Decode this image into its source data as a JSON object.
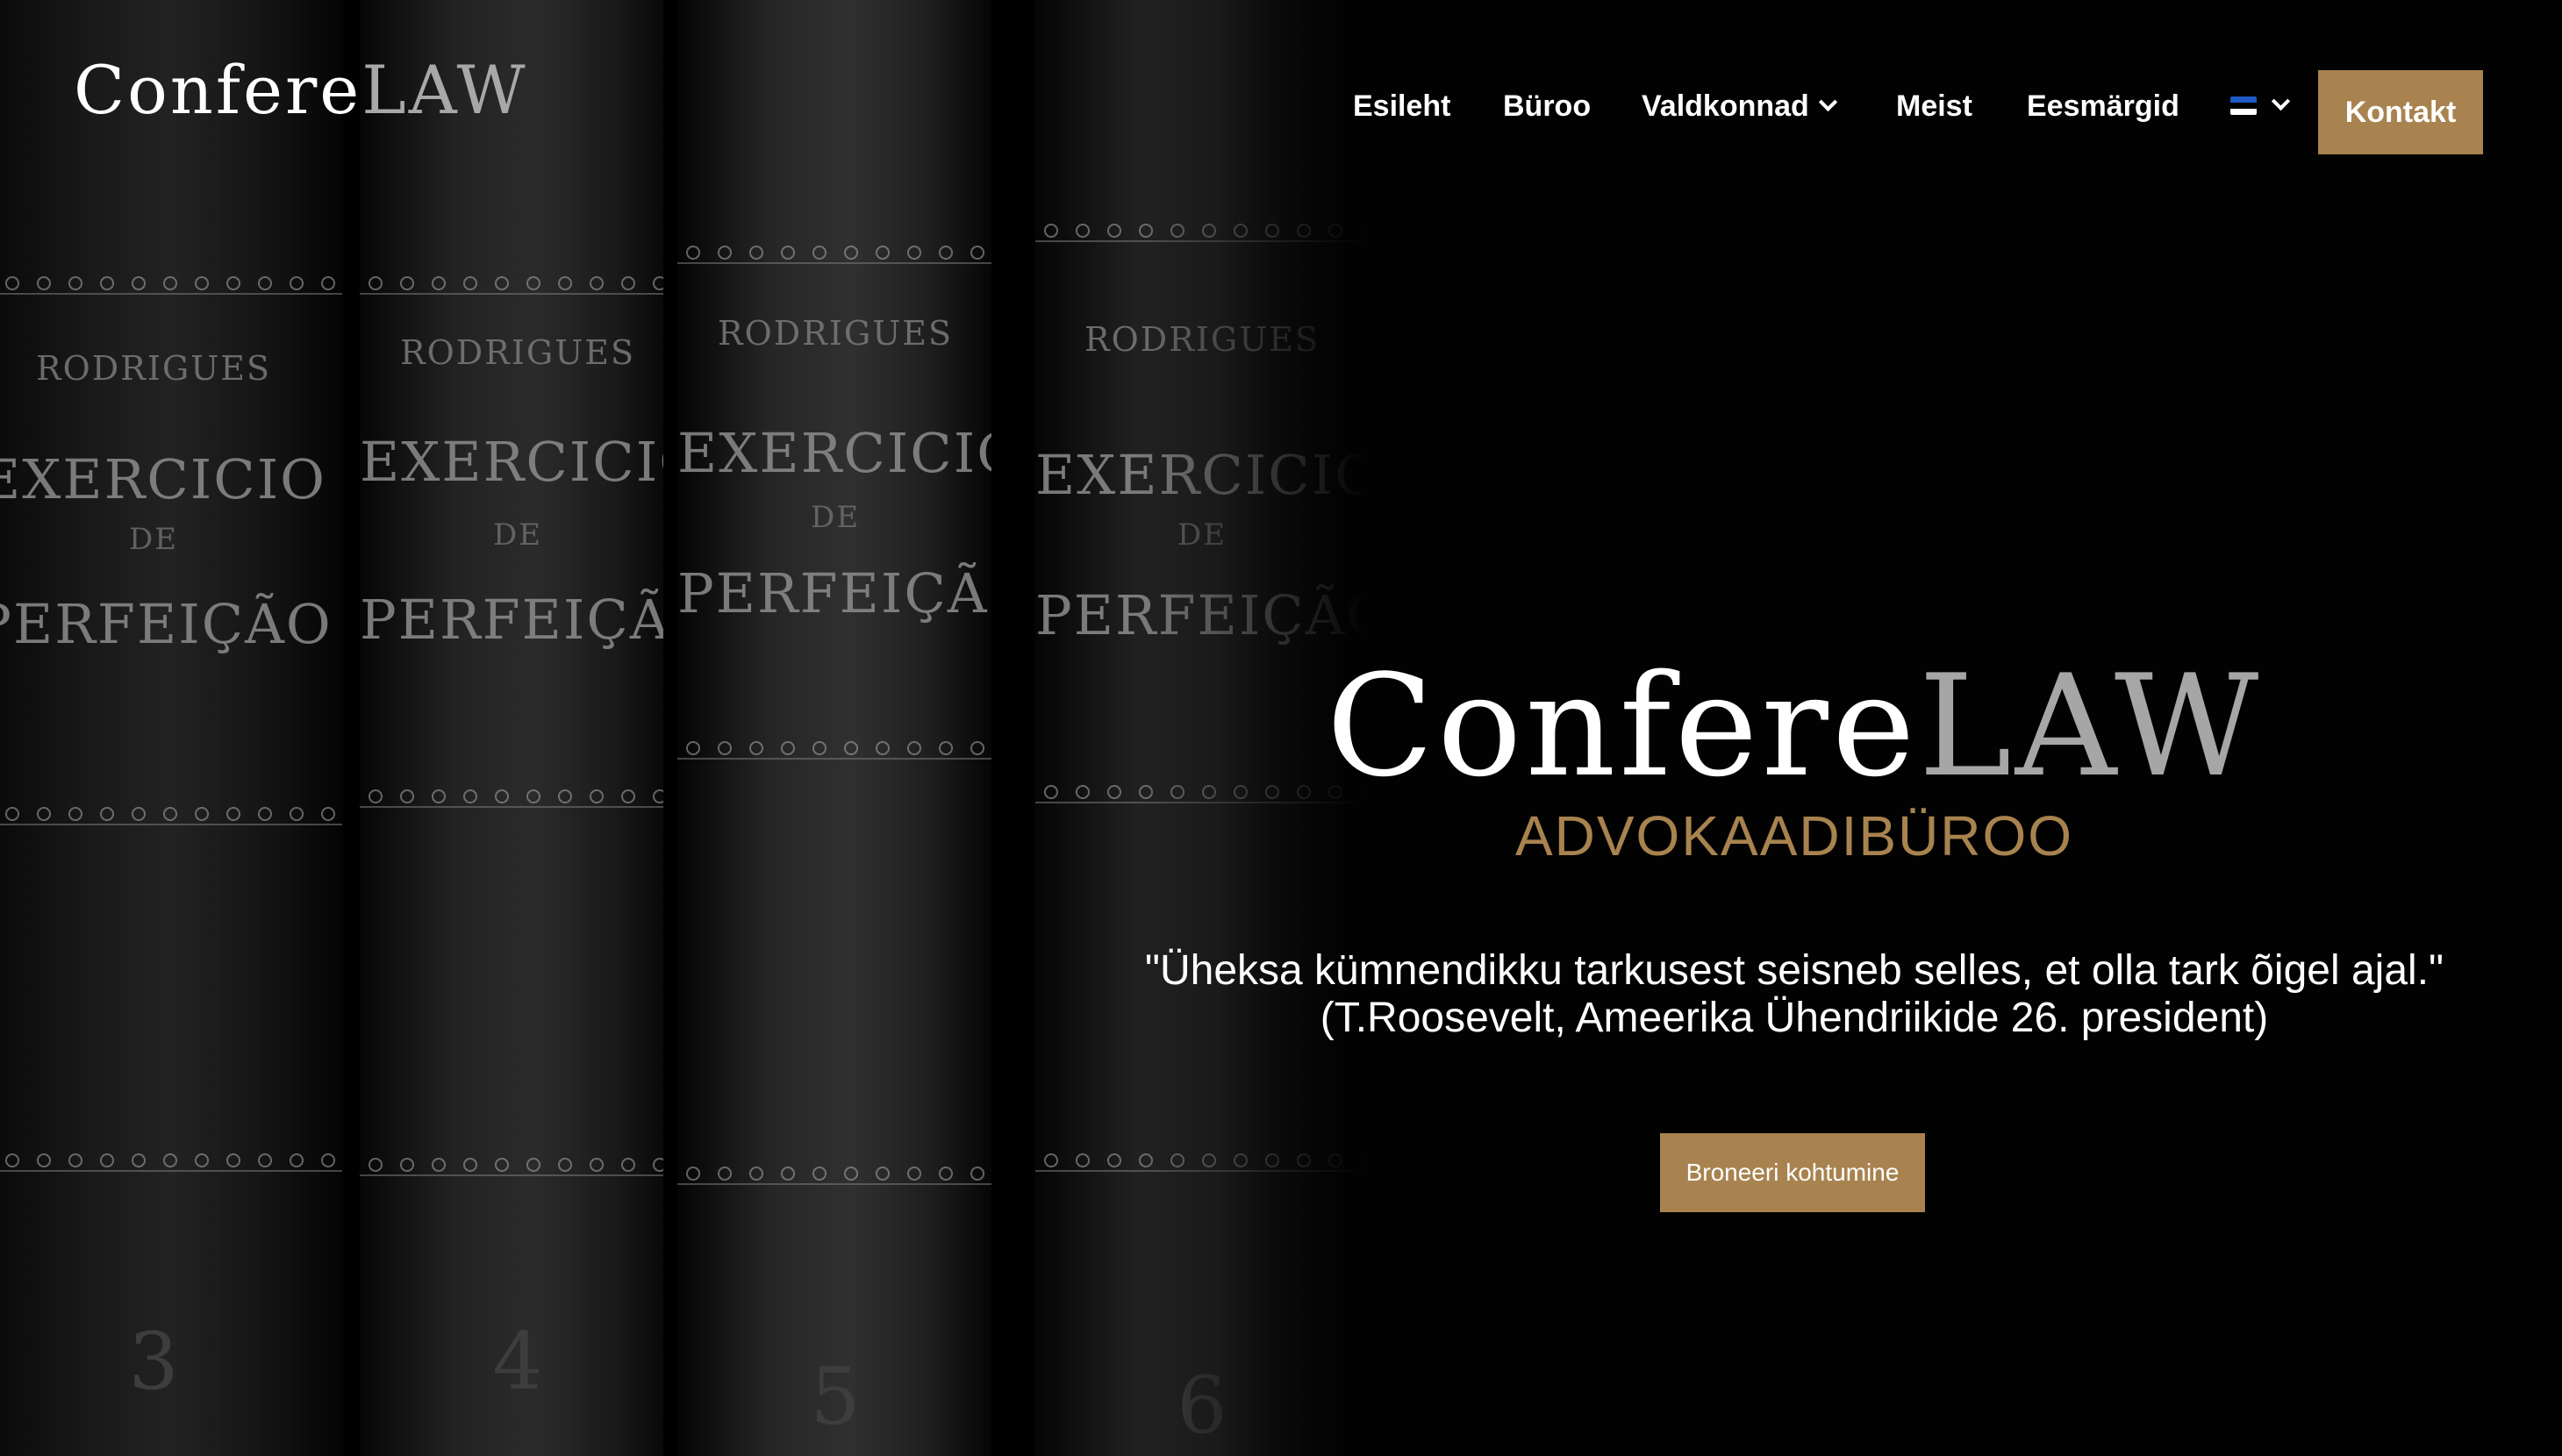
{
  "header": {
    "logo_part1": "Confere",
    "logo_part2": "LAW",
    "nav": [
      {
        "label": "Esileht"
      },
      {
        "label": "Büroo"
      },
      {
        "label": "Valdkonnad"
      },
      {
        "label": "Meist"
      },
      {
        "label": "Eesmärgid"
      }
    ],
    "contact_label": "Kontakt"
  },
  "hero": {
    "title_part1": "Confere",
    "title_part2": "LAW",
    "subtitle": "ADVOKAADIBÜROO",
    "quote_line1": "\"Üheksa kümnendikku tarkusest seisneb selles, et olla tark õigel ajal.\"",
    "quote_line2": "(T.Roosevelt, Ameerika Ühendriikide 26. president)",
    "cta_label": "Broneeri kohtumine"
  },
  "background": {
    "books": [
      {
        "author": "RODRIGUES",
        "title1": "EXERCICIO",
        "title2": "DE",
        "title3": "PERFEIÇÃO",
        "number": "3"
      },
      {
        "author": "RODRIGUES",
        "title1": "EXERCICIO",
        "title2": "DE",
        "title3": "PERFEIÇÃO",
        "number": "4"
      },
      {
        "author": "RODRIGUES",
        "title1": "EXERCICIO",
        "title2": "DE",
        "title3": "PERFEIÇÃO",
        "number": "5"
      },
      {
        "author": "RODRIGUES",
        "title1": "EXERCICIO",
        "title2": "DE",
        "title3": "PERFEIÇÃO",
        "number": "6"
      }
    ]
  },
  "colors": {
    "accent": "#a8834f",
    "logo_secondary": "#a8a8a8",
    "background": "#020202"
  },
  "icons": {
    "dropdown": "chevron-down-icon",
    "language": "estonian-flag-icon"
  }
}
